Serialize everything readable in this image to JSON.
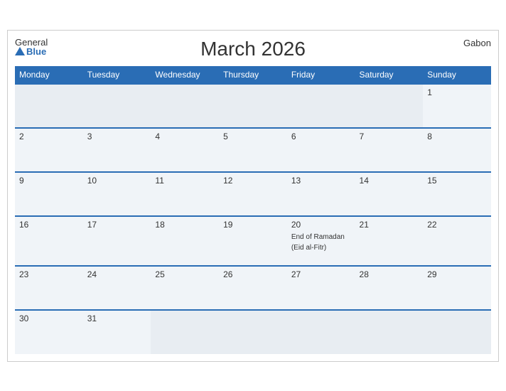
{
  "header": {
    "title": "March 2026",
    "country": "Gabon",
    "logo_general": "General",
    "logo_blue": "Blue"
  },
  "weekdays": [
    "Monday",
    "Tuesday",
    "Wednesday",
    "Thursday",
    "Friday",
    "Saturday",
    "Sunday"
  ],
  "weeks": [
    [
      {
        "day": "",
        "empty": true
      },
      {
        "day": "",
        "empty": true
      },
      {
        "day": "",
        "empty": true
      },
      {
        "day": "",
        "empty": true
      },
      {
        "day": "",
        "empty": true
      },
      {
        "day": "",
        "empty": true
      },
      {
        "day": "1",
        "event": ""
      }
    ],
    [
      {
        "day": "2",
        "event": ""
      },
      {
        "day": "3",
        "event": ""
      },
      {
        "day": "4",
        "event": ""
      },
      {
        "day": "5",
        "event": ""
      },
      {
        "day": "6",
        "event": ""
      },
      {
        "day": "7",
        "event": ""
      },
      {
        "day": "8",
        "event": ""
      }
    ],
    [
      {
        "day": "9",
        "event": ""
      },
      {
        "day": "10",
        "event": ""
      },
      {
        "day": "11",
        "event": ""
      },
      {
        "day": "12",
        "event": ""
      },
      {
        "day": "13",
        "event": ""
      },
      {
        "day": "14",
        "event": ""
      },
      {
        "day": "15",
        "event": ""
      }
    ],
    [
      {
        "day": "16",
        "event": ""
      },
      {
        "day": "17",
        "event": ""
      },
      {
        "day": "18",
        "event": ""
      },
      {
        "day": "19",
        "event": ""
      },
      {
        "day": "20",
        "event": "End of Ramadan\n(Eid al-Fitr)"
      },
      {
        "day": "21",
        "event": ""
      },
      {
        "day": "22",
        "event": ""
      }
    ],
    [
      {
        "day": "23",
        "event": ""
      },
      {
        "day": "24",
        "event": ""
      },
      {
        "day": "25",
        "event": ""
      },
      {
        "day": "26",
        "event": ""
      },
      {
        "day": "27",
        "event": ""
      },
      {
        "day": "28",
        "event": ""
      },
      {
        "day": "29",
        "event": ""
      }
    ],
    [
      {
        "day": "30",
        "event": ""
      },
      {
        "day": "31",
        "event": ""
      },
      {
        "day": "",
        "empty": true
      },
      {
        "day": "",
        "empty": true
      },
      {
        "day": "",
        "empty": true
      },
      {
        "day": "",
        "empty": true
      },
      {
        "day": "",
        "empty": true
      }
    ]
  ]
}
